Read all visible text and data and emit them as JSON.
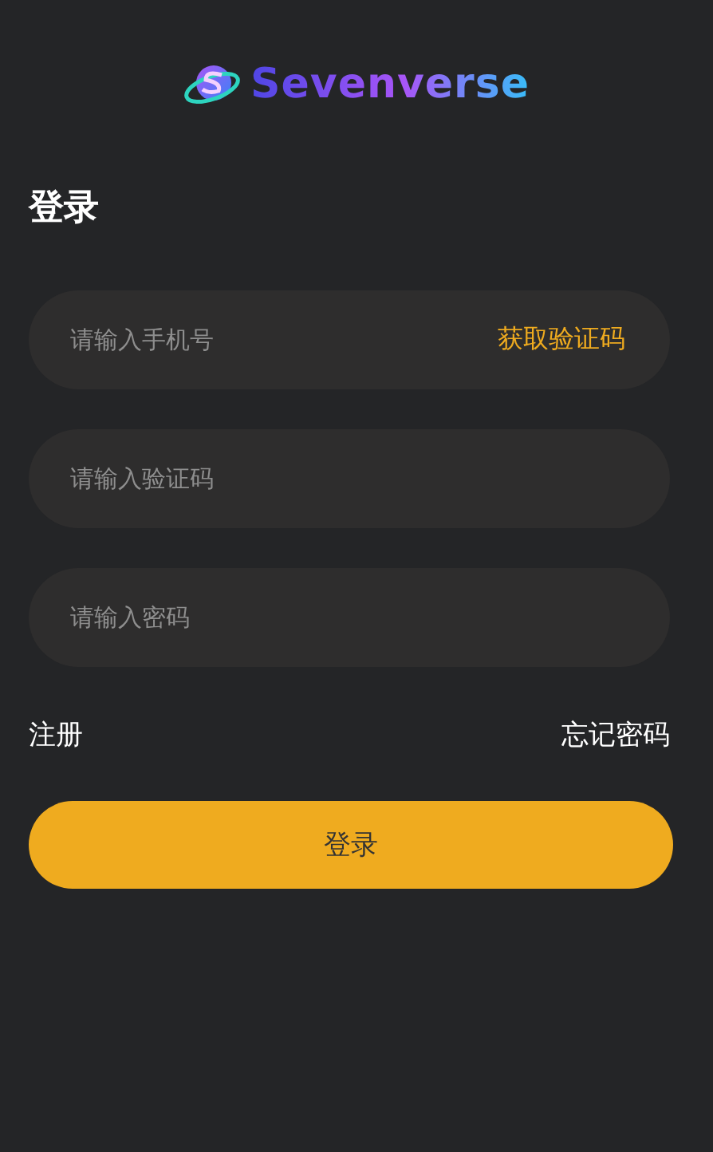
{
  "logo": {
    "text": "Sevenverse"
  },
  "title": "登录",
  "fields": [
    {
      "placeholder": "请输入手机号",
      "kind": "code",
      "action": "获取验证码"
    },
    {
      "placeholder": "请输入验证码",
      "kind": "plain"
    },
    {
      "placeholder": "请输入密码",
      "kind": "password"
    }
  ],
  "links": {
    "register": "注册",
    "forgot": "忘记密码"
  },
  "submit": "登录"
}
